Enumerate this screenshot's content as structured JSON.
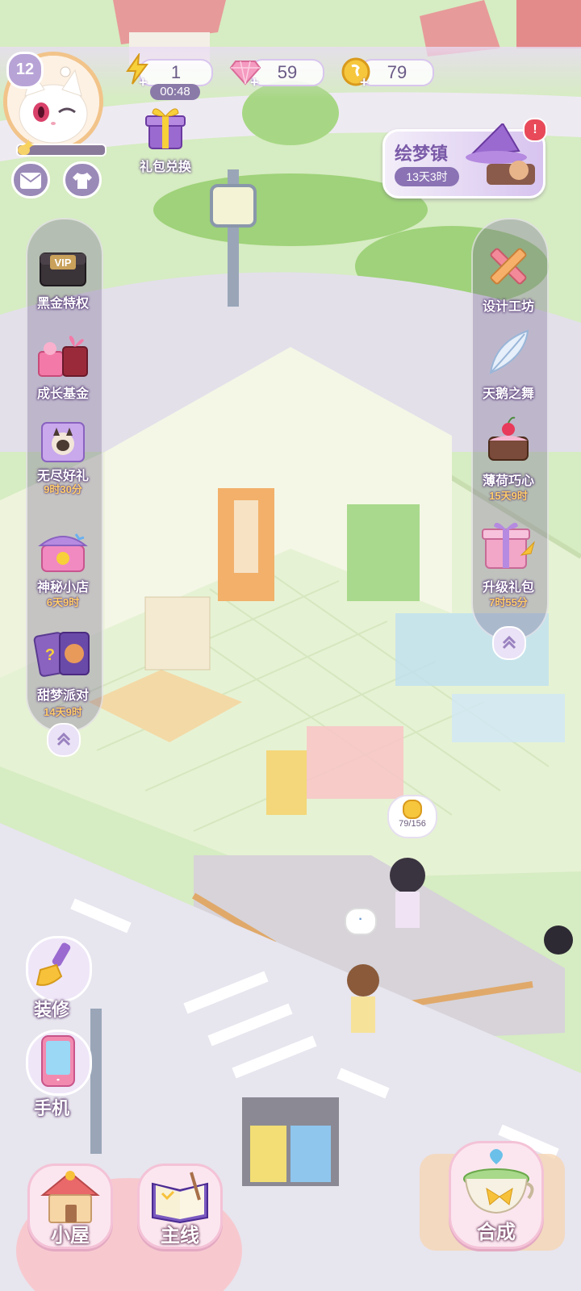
{
  "player": {
    "level": "12"
  },
  "resources": {
    "energy": "1",
    "energy_timer": "00:48",
    "gems": "59",
    "coins": "79"
  },
  "gift_exchange": {
    "label": "礼包兑换"
  },
  "event_banner": {
    "title": "绘梦镇",
    "timer": "13天3时"
  },
  "left_menu": {
    "items": [
      {
        "label": "黑金特权",
        "timer": "",
        "icon": "vip-chest-icon"
      },
      {
        "label": "成长基金",
        "timer": "",
        "icon": "gift-boxes-icon"
      },
      {
        "label": "无尽好礼",
        "timer": "9时30分",
        "icon": "cat-gift-icon"
      },
      {
        "label": "神秘小店",
        "timer": "6天9时",
        "icon": "mystery-shop-icon"
      },
      {
        "label": "甜梦派对",
        "timer": "14天9时",
        "icon": "party-cards-icon"
      }
    ]
  },
  "right_menu": {
    "items": [
      {
        "label": "设计工坊",
        "timer": "",
        "icon": "ruler-pencil-icon"
      },
      {
        "label": "天鹅之舞",
        "timer": "",
        "icon": "feather-icon"
      },
      {
        "label": "薄荷巧心",
        "timer": "15天9时",
        "icon": "cake-icon"
      },
      {
        "label": "升级礼包",
        "timer": "7时55分",
        "icon": "gift-box-icon"
      }
    ]
  },
  "shop_counter": {
    "coin_progress": "79/156"
  },
  "action_buttons": {
    "decorate": "装修",
    "phone": "手机"
  },
  "bottom_nav": {
    "house": "小屋",
    "main_quest": "主线",
    "merge": "合成"
  },
  "speech_bubble": {
    "text": "·"
  },
  "colors": {
    "panel": "#8a76a6",
    "accent_pink": "#f4c2d6",
    "grass": "#cfe8b8",
    "floor": "#e6f2d4",
    "road": "#e8e6ee"
  }
}
